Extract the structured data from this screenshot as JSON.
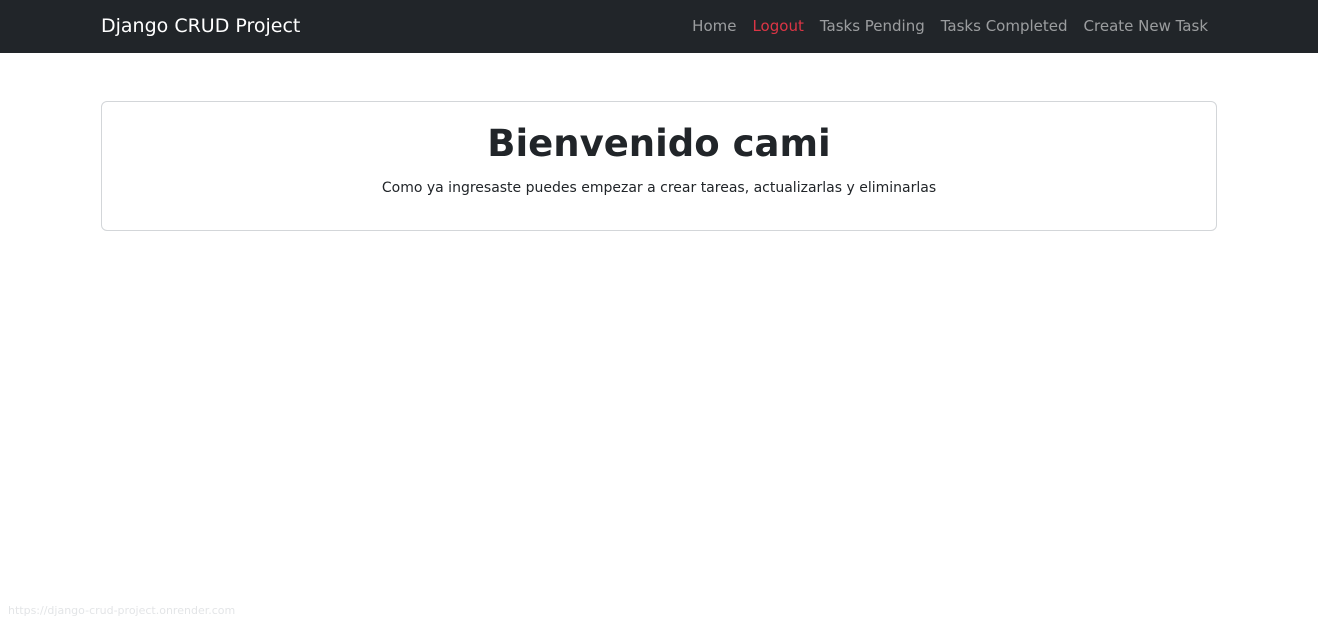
{
  "navbar": {
    "brand": "Django CRUD Project",
    "links": [
      {
        "label": "Home",
        "color": "#bfc1c4"
      },
      {
        "label": "Logout",
        "color": "#dc3545"
      },
      {
        "label": "Tasks Pending",
        "color": "#bfc1c4"
      },
      {
        "label": "Tasks Completed",
        "color": "#bfc1c4"
      },
      {
        "label": "Create New Task",
        "color": "#bfc1c4"
      }
    ]
  },
  "main": {
    "heading": "Bienvenido cami",
    "message": "Como ya ingresaste puedes empezar a crear tareas, actualizarlas y eliminarlas"
  },
  "status_bar": {
    "url": "https://django-crud-project.onrender.com"
  },
  "colors": {
    "navbar_bg": "#212529",
    "danger": "#dc3545"
  }
}
